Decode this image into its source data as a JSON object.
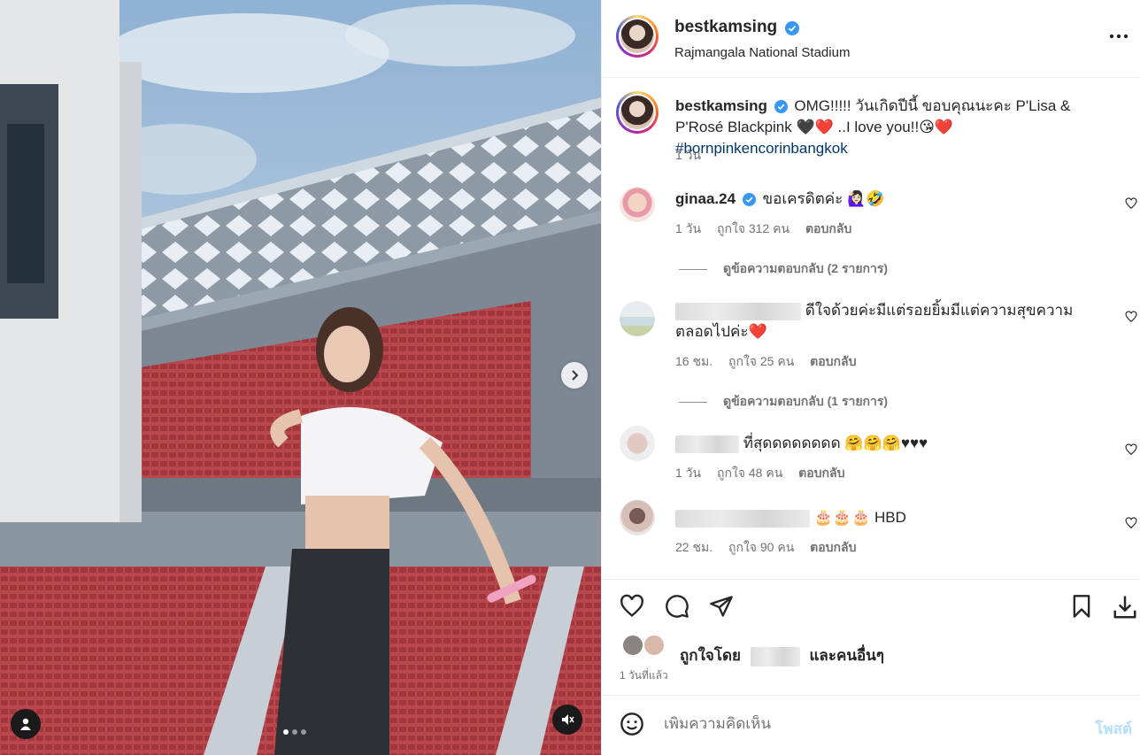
{
  "post": {
    "username": "bestkamsing",
    "location": "Rajmangala National Stadium",
    "caption_user": "bestkamsing",
    "caption_text": "OMG!!!!! วันเกิดปีนี้ ขอบคุณนะคะ P'Lisa & P'Rosé Blackpink 🖤❤️ ..I love you!!😘❤️",
    "caption_hashtag": "#bornpinkencorinbangkok",
    "caption_time": "1 วัน"
  },
  "comments": [
    {
      "username": "ginaa.24",
      "verified": true,
      "text": "ขอเครดิตค่ะ 🙋🏻‍♀️🤣",
      "time": "1 วัน",
      "likes": "ถูกใจ 312 คน",
      "reply": "ตอบกลับ",
      "view_replies": "ดูข้อความตอบกลับ (2 รายการ)"
    },
    {
      "username": "",
      "text": "ดีใจด้วยค่ะมีแต่รอยยิ้มมีแต่ความสุขความตลอดไปค่ะ❤️",
      "time": "16 ชม.",
      "likes": "ถูกใจ 25 คน",
      "reply": "ตอบกลับ",
      "view_replies": "ดูข้อความตอบกลับ (1 รายการ)"
    },
    {
      "username": "",
      "text": "ที่สุดดดดดดดด 🤗🤗🤗♥♥♥",
      "time": "1 วัน",
      "likes": "ถูกใจ 48 คน",
      "reply": "ตอบกลับ"
    },
    {
      "username": "",
      "text": "🎂🎂🎂 HBD",
      "time": "22 ชม.",
      "likes": "ถูกใจ 90 คน",
      "reply": "ตอบกลับ"
    }
  ],
  "likes_summary": {
    "prefix": "ถูกใจโดย",
    "suffix": "และคนอื่นๆ"
  },
  "time_ago": "1 วันที่แล้ว",
  "add_comment": {
    "placeholder": "เพิ่มความคิดเห็น",
    "post_label": "โพสต์"
  },
  "icons": {
    "like": "heart-icon",
    "comment": "comment-icon",
    "share": "paper-plane-icon",
    "save": "bookmark-icon",
    "download": "download-icon",
    "emoji": "smiley-icon",
    "more": "ellipsis-icon",
    "next": "chevron-right-icon",
    "tag": "user-tag-icon",
    "mute": "muted-speaker-icon"
  },
  "colors": {
    "verified": "#3897f0",
    "hashtag": "#00376b",
    "post_disabled": "#b2dffc",
    "meta": "#737373"
  },
  "carousel": {
    "count": 3,
    "active": 1
  }
}
